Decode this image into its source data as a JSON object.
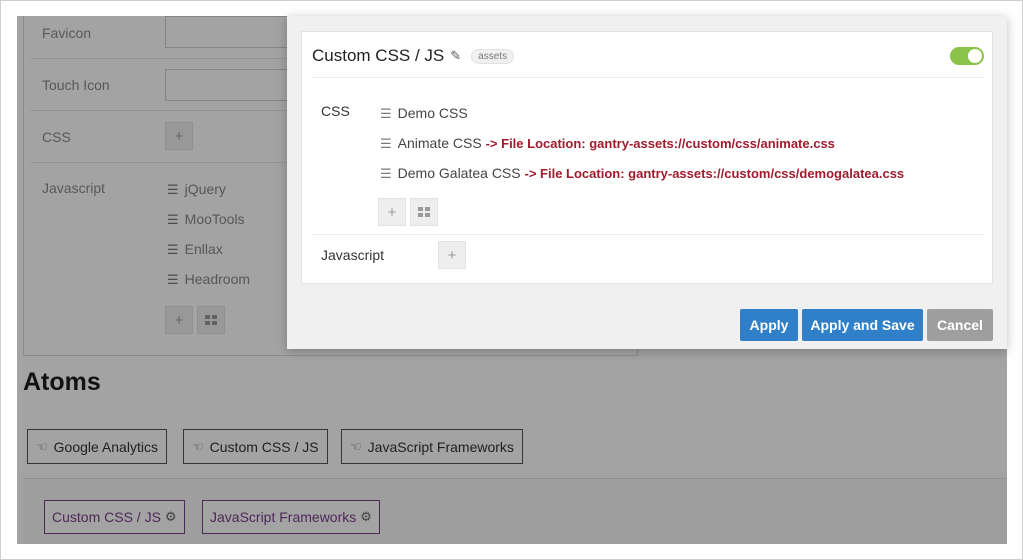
{
  "background": {
    "fields": {
      "favicon_label": "Favicon",
      "touch_icon_label": "Touch Icon",
      "css_label": "CSS",
      "javascript_label": "Javascript"
    },
    "js_items": [
      "jQuery",
      "MooTools",
      "Enllax",
      "Headroom"
    ],
    "atoms_title": "Atoms",
    "atom_types": [
      "Google Analytics",
      "Custom CSS / JS",
      "JavaScript Frameworks"
    ],
    "atom_instances": [
      "Custom CSS / JS",
      "JavaScript Frameworks"
    ]
  },
  "modal": {
    "title": "Custom CSS / JS",
    "badge": "assets",
    "enabled": true,
    "css_label": "CSS",
    "css_items": [
      {
        "name": "Demo CSS",
        "location": ""
      },
      {
        "name": "Animate CSS",
        "location": "-> File Location: gantry-assets://custom/css/animate.css"
      },
      {
        "name": "Demo Galatea CSS",
        "location": "-> File Location: gantry-assets://custom/css/demogalatea.css"
      }
    ],
    "javascript_label": "Javascript",
    "buttons": {
      "apply": "Apply",
      "apply_save": "Apply and Save",
      "cancel": "Cancel"
    }
  },
  "colors": {
    "primary": "#2f80c8",
    "toggle_on": "#8bc34a",
    "location_text": "#a11b2d",
    "atom_instance": "#7b3c88"
  }
}
